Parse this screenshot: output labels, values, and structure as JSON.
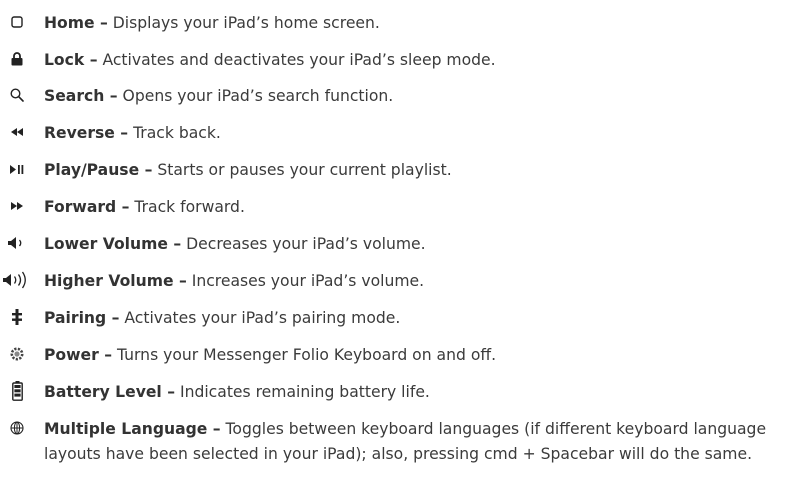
{
  "colors": {
    "text": "#3b3b3b",
    "icon": "#222222",
    "background": "#ffffff"
  },
  "keys": [
    {
      "icon": "home-icon",
      "name": "Home –",
      "description": " Displays your iPad’s home screen."
    },
    {
      "icon": "lock-icon",
      "name": "Lock –",
      "description": " Activates and deactivates your iPad’s sleep mode."
    },
    {
      "icon": "search-icon",
      "name": "Search –",
      "description": " Opens your iPad’s search function."
    },
    {
      "icon": "reverse-icon",
      "name": "Reverse –",
      "description": " Track back."
    },
    {
      "icon": "play-pause-icon",
      "name": "Play/Pause –",
      "description": " Starts or pauses your current playlist."
    },
    {
      "icon": "forward-icon",
      "name": "Forward –",
      "description": " Track forward."
    },
    {
      "icon": "lower-volume-icon",
      "name": "Lower Volume –",
      "description": " Decreases your iPad’s volume."
    },
    {
      "icon": "higher-volume-icon",
      "name": "Higher Volume –",
      "description": " Increases your iPad’s volume."
    },
    {
      "icon": "pairing-icon",
      "name": "Pairing –",
      "description": " Activates your iPad’s pairing mode."
    },
    {
      "icon": "power-icon",
      "name": "Power –",
      "description": " Turns your Messenger Folio Keyboard on and off."
    },
    {
      "icon": "battery-icon",
      "name": "Battery Level –",
      "description": " Indicates remaining battery life."
    },
    {
      "icon": "globe-icon",
      "name": "Multiple Language –",
      "description": " Toggles between keyboard languages (if different keyboard language layouts have been selected in your iPad); also, pressing  cmd  + Spacebar will do the same."
    }
  ]
}
